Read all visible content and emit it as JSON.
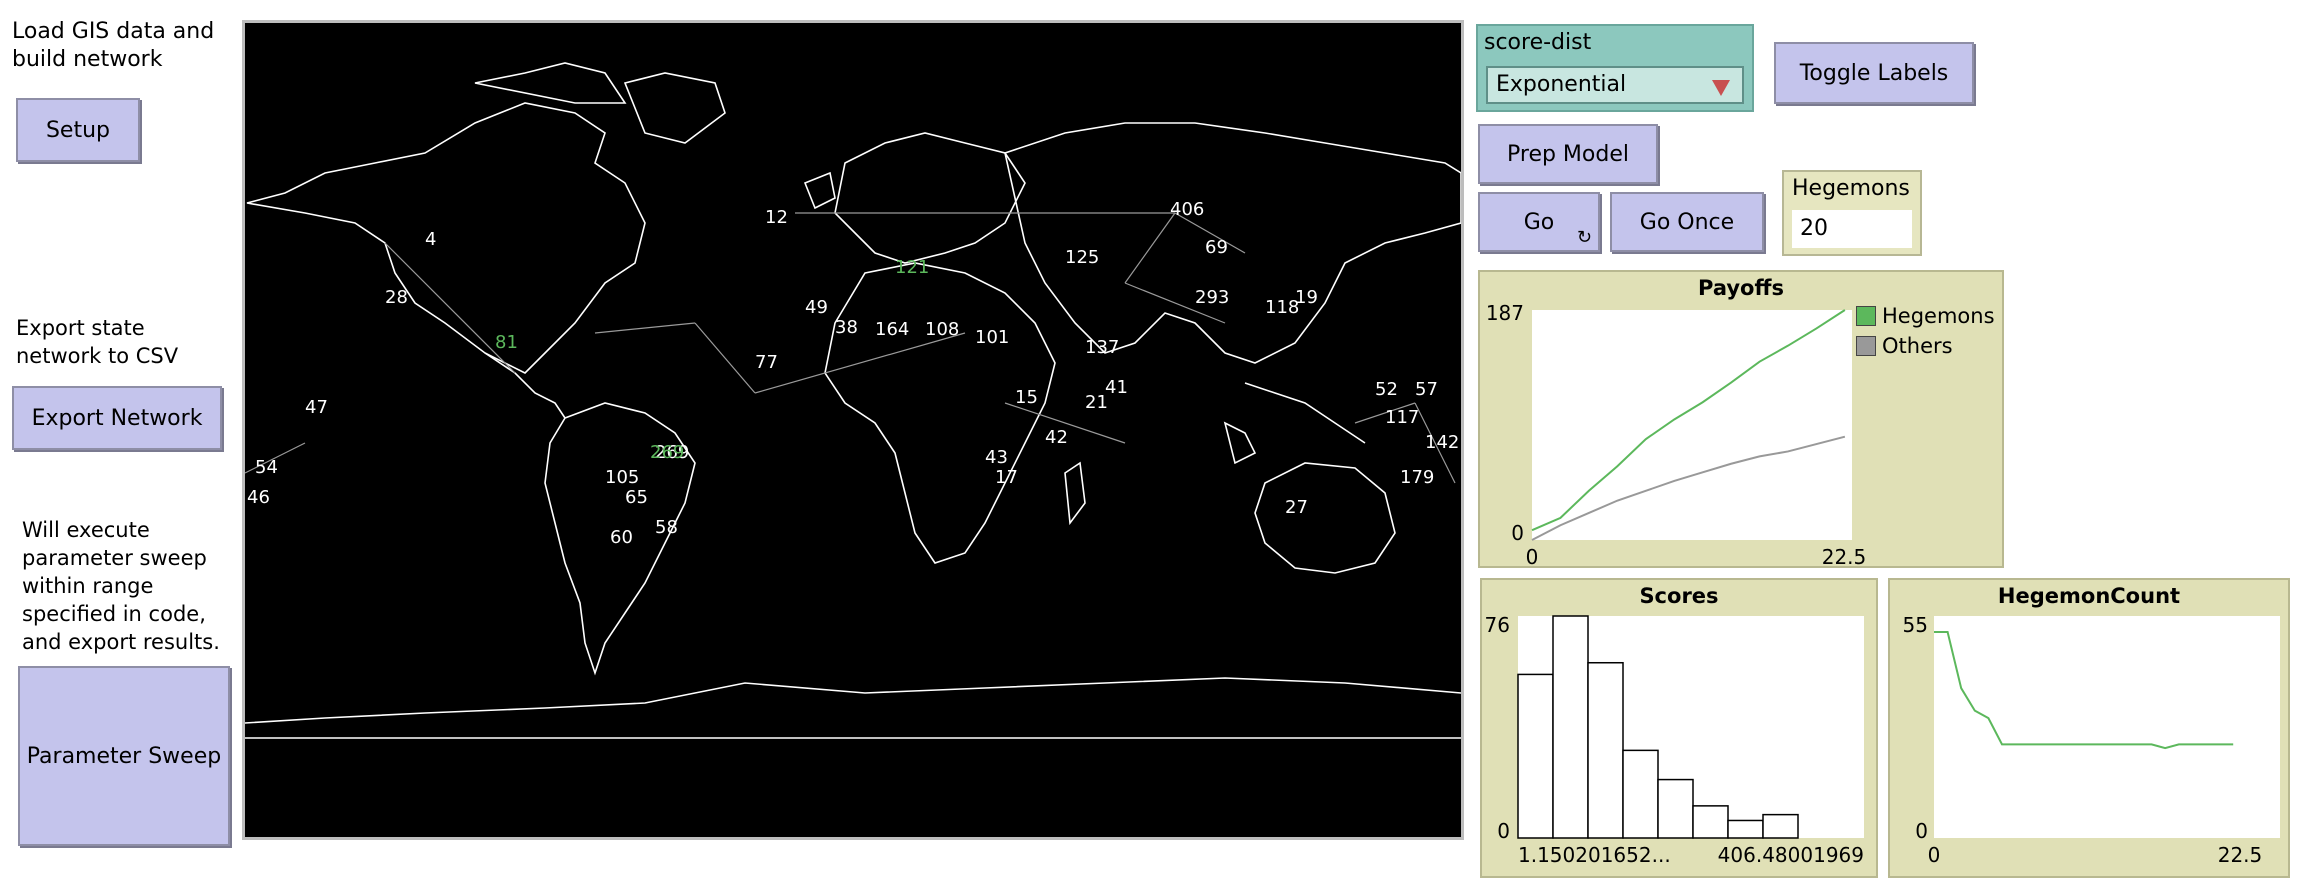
{
  "left_panel": {
    "load_note": "Load GIS data and build network",
    "setup_label": "Setup",
    "export_note": "Export state network to CSV",
    "export_label": "Export Network",
    "sweep_note": "Will execute parameter sweep within range specified in code, and export results.",
    "sweep_label": "Parameter Sweep"
  },
  "controls": {
    "chooser_label": "score-dist",
    "chooser_value": "Exponential",
    "toggle_labels": "Toggle Labels",
    "prep_model": "Prep Model",
    "go": "Go",
    "go_once": "Go Once",
    "hegemons_label": "Hegemons",
    "hegemons_value": "20"
  },
  "colors": {
    "hegemons": "#5cb85c",
    "others": "#999999",
    "button": "#c4c4ec",
    "chooser": "#8cc8be",
    "plot_bg": "#e0e0b6"
  },
  "map": {
    "node_labels": [
      "4",
      "28",
      "406",
      "69",
      "293",
      "125",
      "42",
      "21",
      "41",
      "27",
      "52",
      "57",
      "117",
      "142",
      "179",
      "47",
      "54",
      "46",
      "269",
      "105",
      "65",
      "60",
      "58",
      "12",
      "49",
      "38",
      "164",
      "108",
      "101",
      "77",
      "137",
      "19",
      "118",
      "15",
      "17",
      "43"
    ],
    "highlight_labels": [
      "81",
      "121",
      "269"
    ]
  },
  "chart_data": [
    {
      "type": "line",
      "title": "Payoffs",
      "ylim": [
        0,
        187
      ],
      "xlim": [
        0,
        22.5
      ],
      "y_tick_labels": [
        "187",
        "0"
      ],
      "x_tick_labels": [
        "0",
        "22.5"
      ],
      "legend": [
        "Hegemons",
        "Others"
      ],
      "series": [
        {
          "name": "Hegemons",
          "x": [
            0,
            2,
            4,
            6,
            8,
            10,
            12,
            14,
            16,
            18,
            20,
            22
          ],
          "values": [
            8,
            18,
            40,
            60,
            82,
            98,
            112,
            128,
            145,
            158,
            172,
            187
          ]
        },
        {
          "name": "Others",
          "x": [
            0,
            2,
            4,
            6,
            8,
            10,
            12,
            14,
            16,
            18,
            20,
            22
          ],
          "values": [
            0,
            12,
            22,
            32,
            40,
            48,
            55,
            62,
            68,
            72,
            78,
            84
          ]
        }
      ]
    },
    {
      "type": "bar",
      "title": "Scores",
      "ylim": [
        0,
        76
      ],
      "y_tick_labels": [
        "76",
        "0"
      ],
      "x_tick_labels": [
        "1.150201652...",
        "406.48001969"
      ],
      "values": [
        56,
        76,
        60,
        30,
        20,
        11,
        6,
        8
      ]
    },
    {
      "type": "line",
      "title": "HegemonCount",
      "ylim": [
        0,
        55
      ],
      "xlim": [
        0,
        22.5
      ],
      "y_tick_labels": [
        "55",
        "0"
      ],
      "x_tick_labels": [
        "0",
        "22.5"
      ],
      "series": [
        {
          "x": [
            0,
            1,
            2,
            3,
            4,
            5,
            6,
            7,
            8,
            9,
            10,
            11,
            12,
            13,
            14,
            15,
            16,
            17,
            18,
            19,
            20,
            21,
            22
          ],
          "values": [
            55,
            55,
            40,
            34,
            32,
            25,
            25,
            25,
            25,
            25,
            25,
            25,
            25,
            25,
            25,
            25,
            25,
            24,
            25,
            25,
            25,
            25,
            25
          ]
        }
      ]
    }
  ]
}
